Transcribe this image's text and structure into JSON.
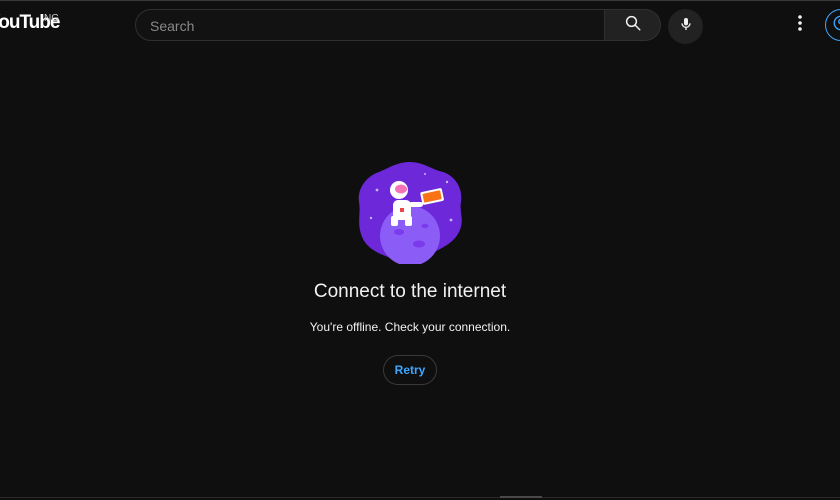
{
  "header": {
    "logo_text": "YouTube",
    "logo_region": "NG",
    "search": {
      "placeholder": "Search",
      "value": ""
    }
  },
  "icons": {
    "search": "search-icon",
    "mic": "microphone-icon",
    "more": "vertical-dots-icon",
    "account": "account-circle-icon",
    "illustration": "astronaut-on-planet-illustration"
  },
  "main": {
    "title": "Connect to the internet",
    "message": "You're offline. Check your connection.",
    "retry_label": "Retry"
  },
  "colors": {
    "background": "#0f0f0f",
    "accent_blue": "#3ea6ff",
    "illustration_purple": "#7c3aed"
  }
}
